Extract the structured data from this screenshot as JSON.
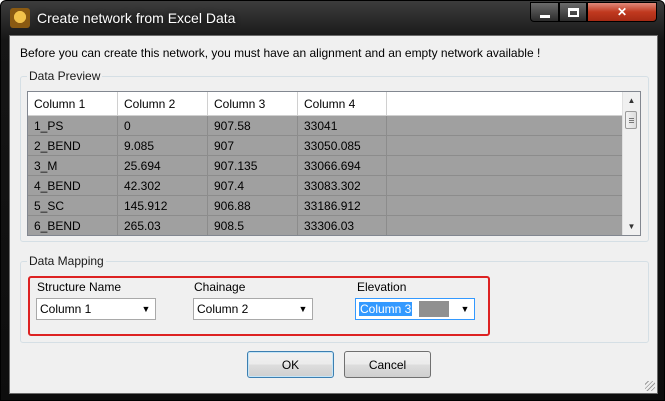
{
  "window": {
    "title": "Create network from Excel Data",
    "icon": "app-logo-icon",
    "controls": {
      "minimize": "minimize-icon",
      "maximize": "maximize-icon",
      "close": "close-icon"
    }
  },
  "message": "Before you can create this network, you must have an alignment and an empty network available !",
  "preview": {
    "group_label": "Data Preview",
    "columns": [
      "Column 1",
      "Column 2",
      "Column 3",
      "Column 4"
    ],
    "rows": [
      [
        "1_PS",
        "0",
        "907.58",
        "33041"
      ],
      [
        "2_BEND",
        "9.085",
        "907",
        "33050.085"
      ],
      [
        "3_M",
        "25.694",
        "907.135",
        "33066.694"
      ],
      [
        "4_BEND",
        "42.302",
        "907.4",
        "33083.302"
      ],
      [
        "5_SC",
        "145.912",
        "906.88",
        "33186.912"
      ],
      [
        "6_BEND",
        "265.03",
        "908.5",
        "33306.03"
      ]
    ]
  },
  "mapping": {
    "group_label": "Data Mapping",
    "structure_name": {
      "label": "Structure Name",
      "value": "Column 1"
    },
    "chainage": {
      "label": "Chainage",
      "value": "Column 2"
    },
    "elevation": {
      "label": "Elevation",
      "value": "Column 3"
    }
  },
  "buttons": {
    "ok": "OK",
    "cancel": "Cancel"
  },
  "colors": {
    "highlight_box": "#dd2222",
    "selected_row": "#a0a0a0",
    "selection": "#3399ff"
  }
}
